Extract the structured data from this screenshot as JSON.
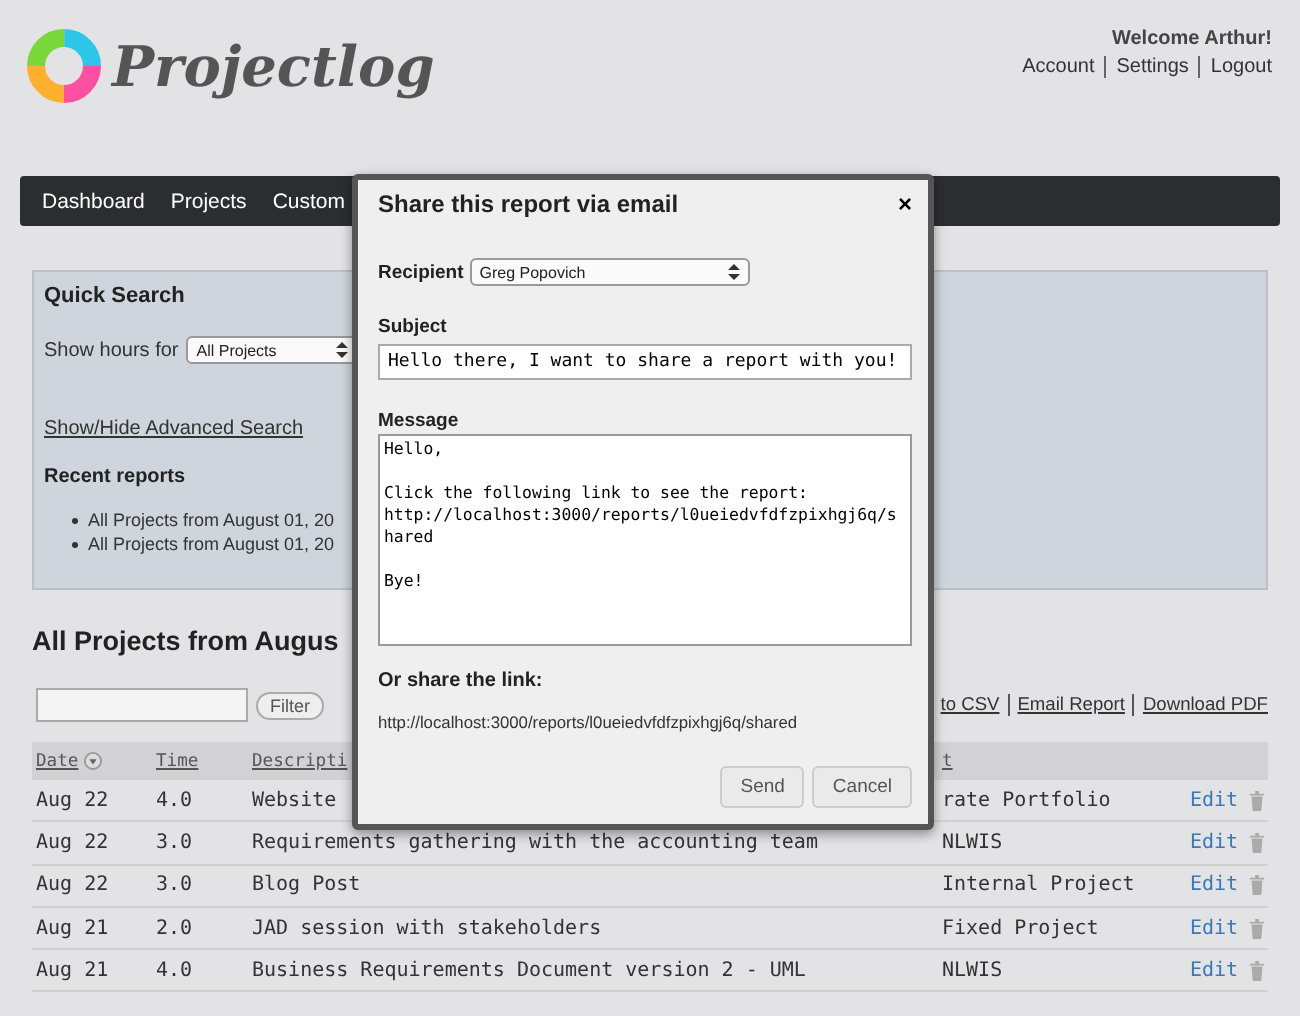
{
  "header": {
    "logo": "Projectlog",
    "welcome": "Welcome Arthur!",
    "links": [
      "Account",
      "Settings",
      "Logout"
    ]
  },
  "nav": [
    {
      "label": "Dashboard"
    },
    {
      "label": "Projects"
    },
    {
      "label": "Custom"
    }
  ],
  "quick_search": {
    "title": "Quick Search",
    "show_hours_label": "Show hours for",
    "project_select": "All Projects",
    "advanced_link": "Show/Hide Advanced Search",
    "recent_title": "Recent reports",
    "recent": [
      "All Projects from August 01, 20",
      "All Projects from August 01, 20"
    ]
  },
  "report": {
    "title": "All Projects from Augus",
    "filter_button": "Filter",
    "links": [
      "to CSV",
      "Email Report",
      "Download PDF"
    ]
  },
  "table": {
    "columns": [
      {
        "label": "Date",
        "sorted": true
      },
      {
        "label": "Time"
      },
      {
        "label": "Descripti"
      },
      {
        "label": "t"
      }
    ],
    "rows": [
      {
        "date": "Aug 22",
        "time": "4.0",
        "description": "Website",
        "project": "rate Portfolio",
        "action": "Edit"
      },
      {
        "date": "Aug 22",
        "time": "3.0",
        "description": "Requirements gathering with the accounting team",
        "project": "NLWIS",
        "action": "Edit"
      },
      {
        "date": "Aug 22",
        "time": "3.0",
        "description": "Blog Post",
        "project": "Internal Project",
        "action": "Edit"
      },
      {
        "date": "Aug 21",
        "time": "2.0",
        "description": "JAD session with stakeholders",
        "project": "Fixed Project",
        "action": "Edit"
      },
      {
        "date": "Aug 21",
        "time": "4.0",
        "description": "Business Requirements Document version 2 - UML",
        "project": "NLWIS",
        "action": "Edit"
      }
    ]
  },
  "modal": {
    "title": "Share this report via email",
    "close": "×",
    "recipient_label": "Recipient",
    "recipient": "Greg Popovich",
    "subject_label": "Subject",
    "subject": "Hello there, I want to share a report with you!",
    "message_label": "Message",
    "message": "Hello,\n\nClick the following link to see the report:\nhttp://localhost:3000/reports/l0ueiedvfdfzpixhgj6q/shared\n\nBye!",
    "link_label": "Or share the link:",
    "link": "http://localhost:3000/reports/l0ueiedvfdfzpixhgj6q/shared",
    "buttons": [
      "Send",
      "Cancel"
    ]
  }
}
